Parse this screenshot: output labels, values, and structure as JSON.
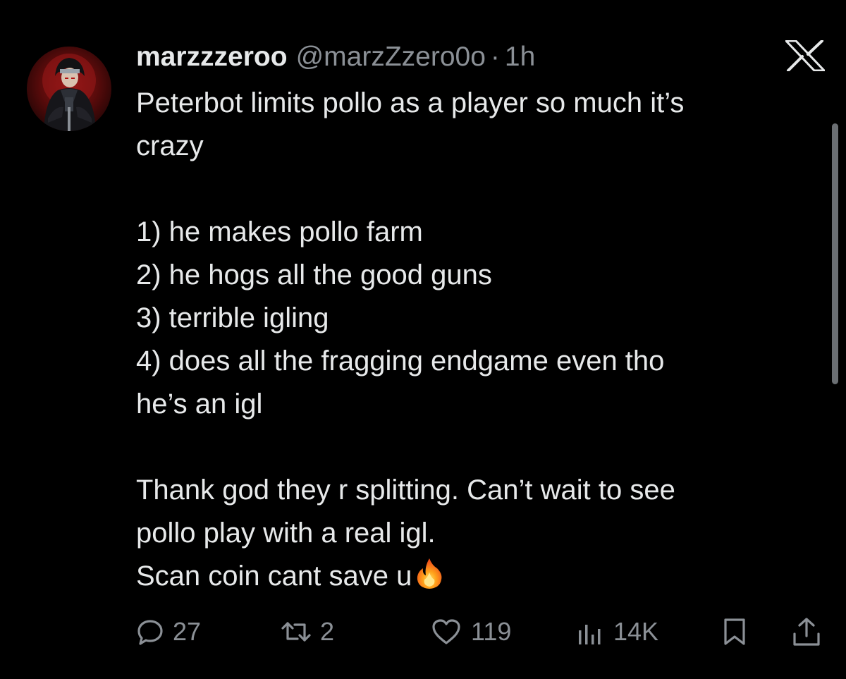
{
  "tweet": {
    "author": {
      "display_name": "marzzzeroo",
      "handle": "@marzZzero0o",
      "separator": "·",
      "time": "1h",
      "avatar_icon": "profile-avatar-icon"
    },
    "app_logo": "x-logo-icon",
    "text_lines": [
      "Peterbot limits pollo as a player so much it’s",
      "crazy",
      "",
      "1) he makes pollo farm",
      "2) he hogs all the good guns",
      "3) terrible igling",
      "4) does all the fragging endgame even tho",
      "he’s an igl",
      "",
      "Thank god they r splitting. Can’t wait to see",
      "pollo play with a real igl.",
      "Scan coin cant save u"
    ],
    "emoji": "fire-emoji",
    "metrics": {
      "replies": "27",
      "reposts": "2",
      "likes": "119",
      "views": "14K"
    }
  },
  "colors": {
    "background": "#000000",
    "primary_text": "#e7e9ea",
    "secondary_text": "#8b9096"
  }
}
